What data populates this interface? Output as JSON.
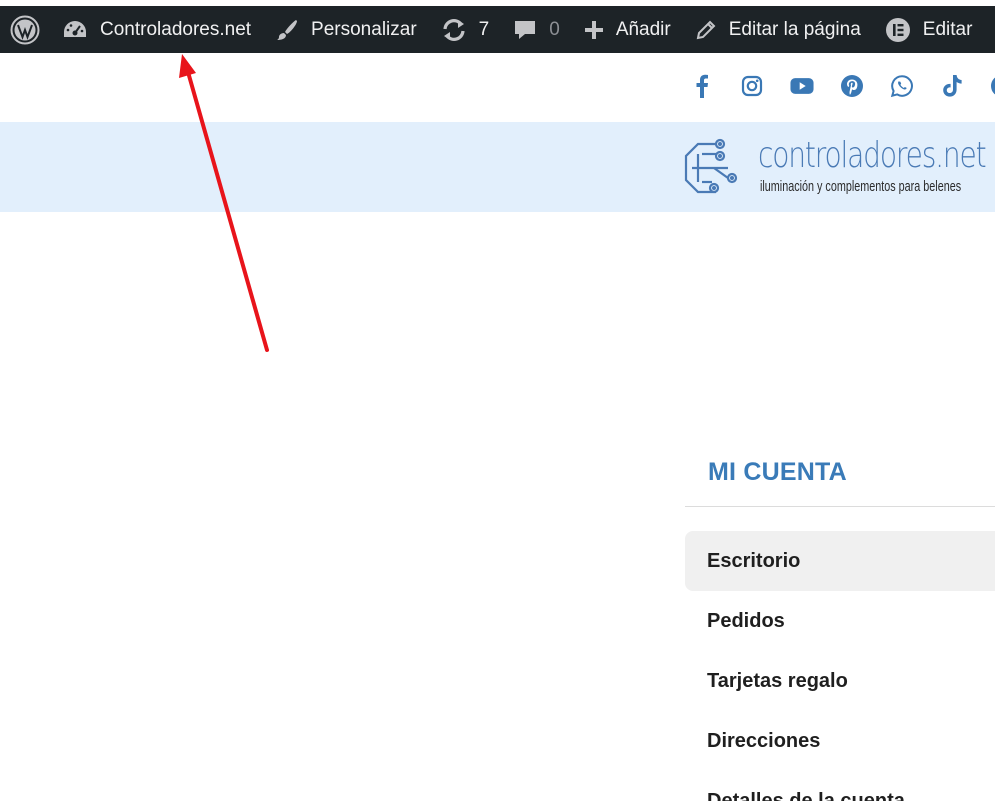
{
  "adminbar": {
    "site_name": "Controladores.net",
    "customize_label": "Personalizar",
    "updates_count": "7",
    "comments_count": "0",
    "add_label": "Añadir",
    "edit_page_label": "Editar la página",
    "edit_elementor_label": "Editar",
    "background_color": "#1d2327"
  },
  "social": {
    "icons": [
      "facebook-icon",
      "instagram-icon",
      "youtube-icon",
      "pinterest-icon",
      "whatsapp-icon",
      "tiktok-icon",
      "telegram-icon"
    ],
    "color": "#3a78b5"
  },
  "header": {
    "logo_title": "controladores.net",
    "logo_tagline": "iluminación y complementos para belenes",
    "band_color": "#e2effc"
  },
  "account": {
    "title": "MI CUENTA",
    "nav": [
      {
        "label": "Escritorio",
        "active": true
      },
      {
        "label": "Pedidos",
        "active": false
      },
      {
        "label": "Tarjetas regalo",
        "active": false
      },
      {
        "label": "Direcciones",
        "active": false
      },
      {
        "label": "Detalles de la cuenta",
        "active": false
      }
    ]
  },
  "annotation": {
    "type": "red-arrow",
    "color": "#e8141b"
  }
}
